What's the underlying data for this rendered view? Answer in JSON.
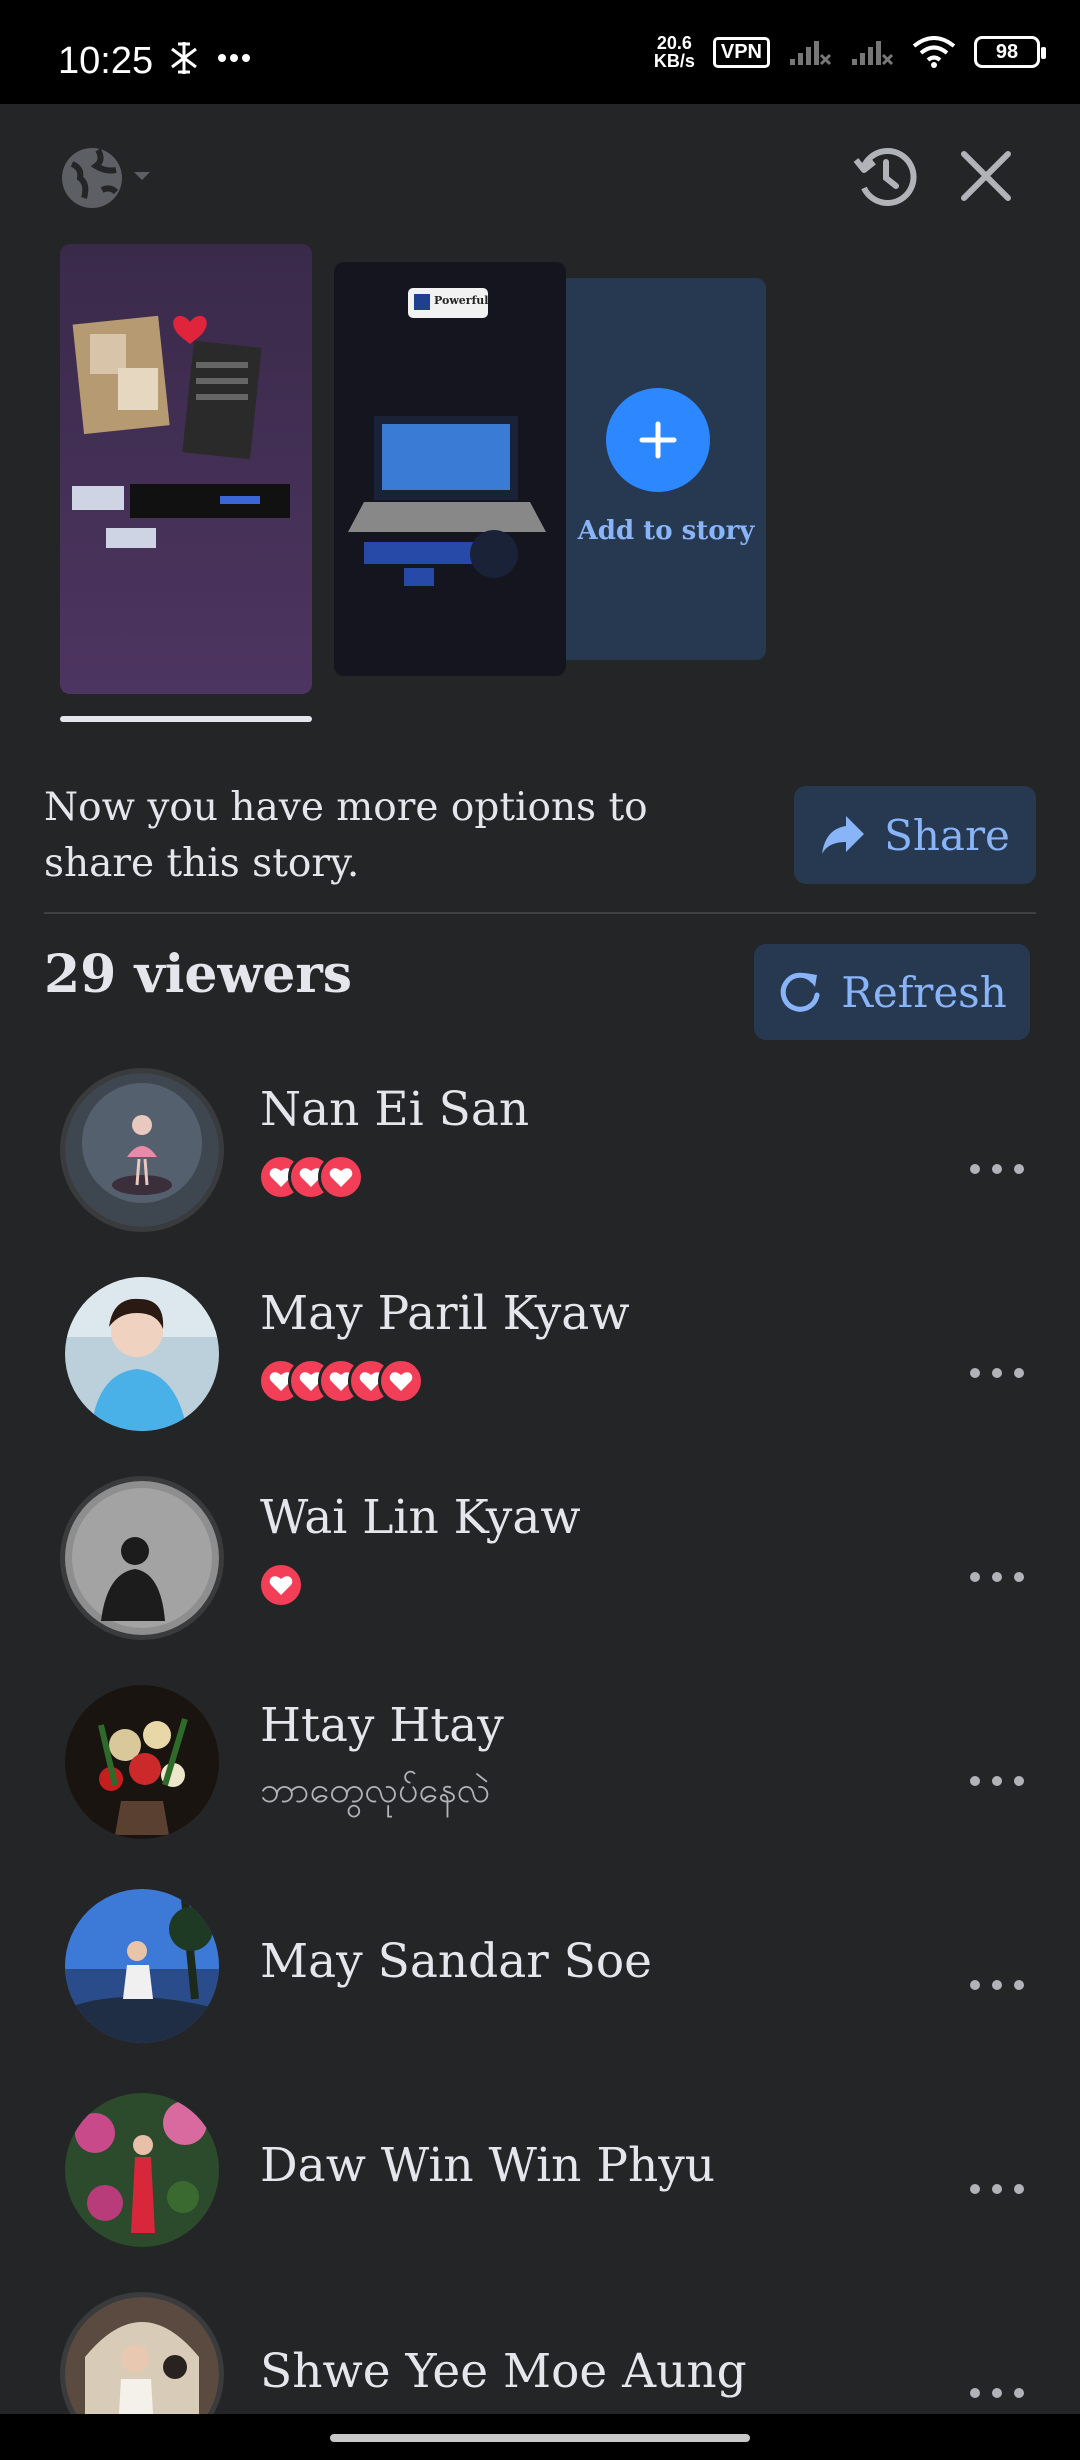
{
  "status_bar": {
    "time": "10:25",
    "net_speed_value": "20.6",
    "net_speed_unit": "KB/s",
    "vpn": "VPN",
    "battery": "98"
  },
  "stories": {
    "add_label": "Add to story",
    "thumb2_card_text": "Powerful"
  },
  "share_banner": {
    "text": "Now you have more options to share this story.",
    "button_label": "Share"
  },
  "viewers": {
    "count_label": "29 viewers",
    "refresh_label": "Refresh",
    "items": [
      {
        "name": "Nan Ei San",
        "reactions": 3,
        "subtitle": ""
      },
      {
        "name": "May Paril Kyaw",
        "reactions": 5,
        "subtitle": ""
      },
      {
        "name": "Wai Lin Kyaw",
        "reactions": 1,
        "subtitle": ""
      },
      {
        "name": "Htay Htay",
        "reactions": 0,
        "subtitle": "ဘာတွေလုပ်နေလဲ"
      },
      {
        "name": "May Sandar Soe",
        "reactions": 0,
        "subtitle": ""
      },
      {
        "name": "Daw Win Win Phyu",
        "reactions": 0,
        "subtitle": ""
      },
      {
        "name": "Shwe Yee Moe Aung",
        "reactions": 0,
        "subtitle": ""
      }
    ]
  },
  "colors": {
    "background": "#242526",
    "accent": "#2d88ff",
    "button_bg": "#263951",
    "button_text": "#8ab4f8",
    "heart": "#f33e58"
  },
  "icons": [
    "globe-icon",
    "history-icon",
    "close-icon",
    "plus-icon",
    "share-arrow-icon",
    "refresh-icon",
    "heart-icon",
    "more-icon"
  ]
}
